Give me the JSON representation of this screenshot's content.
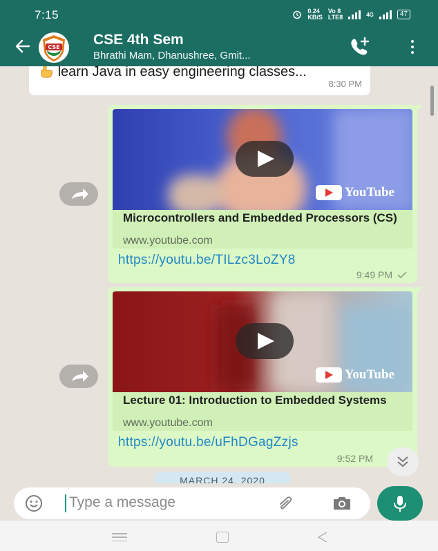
{
  "status_bar": {
    "time": "7:15",
    "speed": "0.24",
    "speed_unit": "KB/S",
    "volte": "Vo 8",
    "lte": "LTE8",
    "network": "4G",
    "battery": "47"
  },
  "header": {
    "title": "CSE 4th Sem",
    "subtitle": "Bhrathi Mam, Dhanushree, Gmit...",
    "avatar_text": "CSE",
    "icons": [
      "back-arrow-icon",
      "add-call-icon",
      "more-vert-icon"
    ]
  },
  "messages": [
    {
      "type": "incoming",
      "text": "learn Java in easy engineering classes...",
      "time": "8:30 PM"
    },
    {
      "type": "outgoing",
      "preview_title": "Microcontrollers and Embedded Processors (CS)",
      "domain": "www.youtube.com",
      "brand": "YouTube",
      "link": "https://youtu.be/TILzc3LoZY8",
      "time": "9:49 PM"
    },
    {
      "type": "outgoing",
      "preview_title": "Lecture 01: Introduction to Embedded Systems",
      "domain": "www.youtube.com",
      "brand": "YouTube",
      "link": "https://youtu.be/uFhDGagZzjs",
      "time": "9:52 PM"
    }
  ],
  "date_divider": "MARCH 24, 2020",
  "composer": {
    "placeholder": "Type a message"
  },
  "colors": {
    "header": "#1c6e63",
    "outgoing_bubble": "#dcf8c6",
    "link": "#1e88c6",
    "mic_button": "#1c8f75"
  }
}
